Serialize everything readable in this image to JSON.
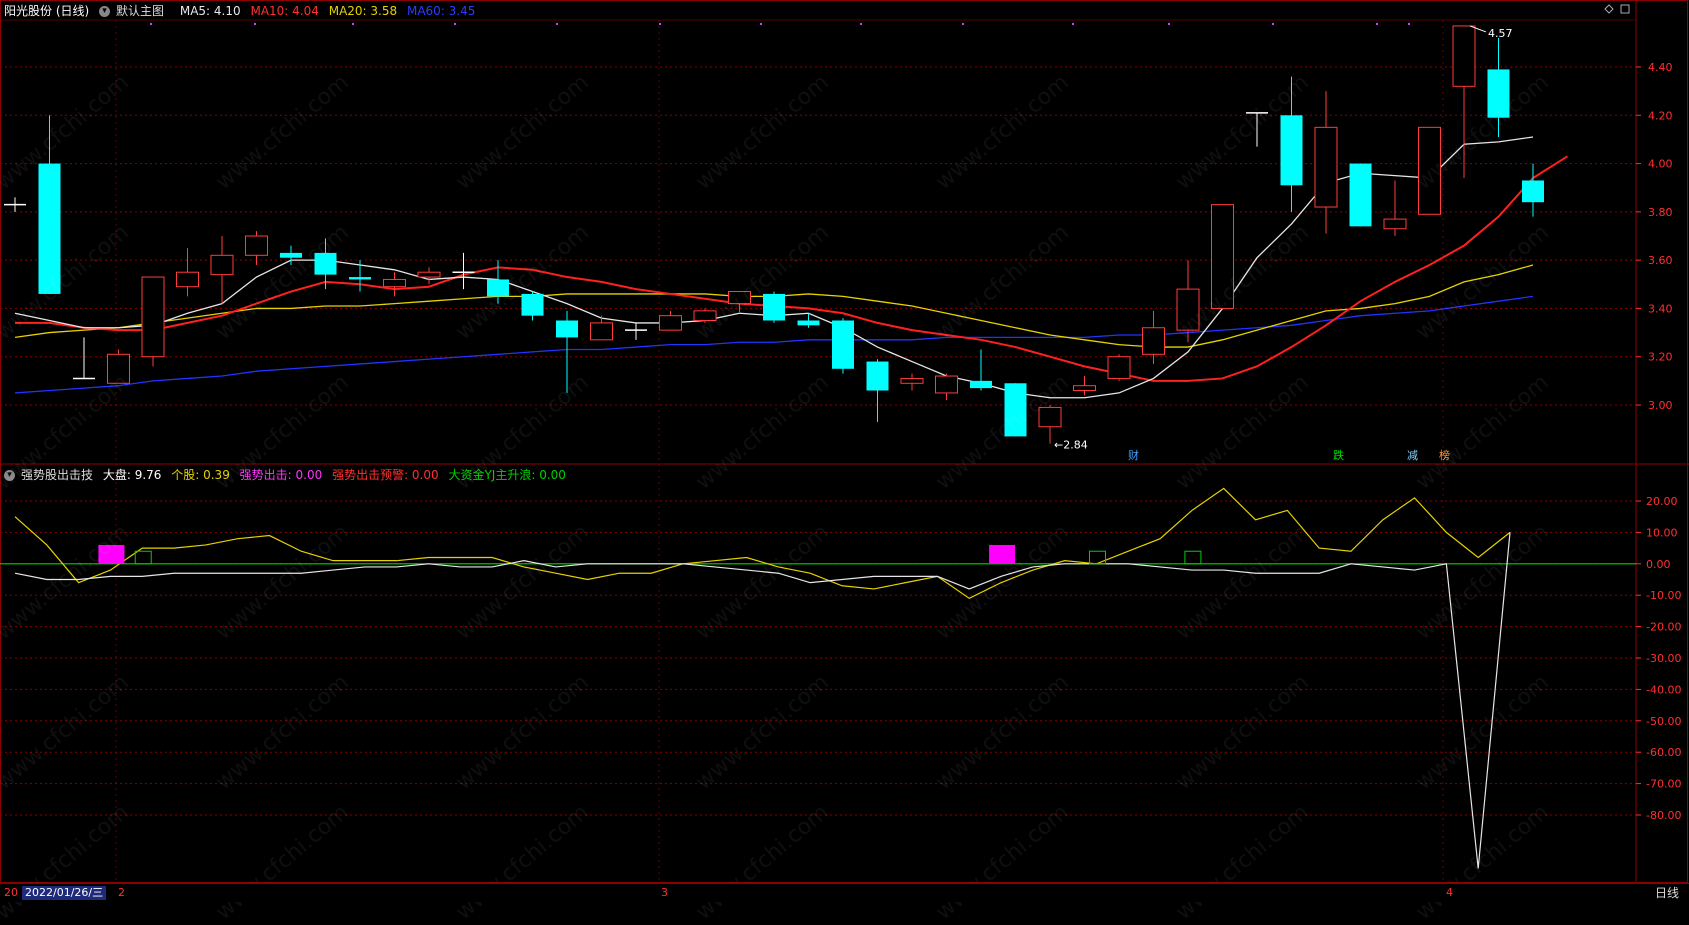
{
  "header": {
    "stock": "阳光股份 (日线)",
    "template": "默认主图",
    "ma5_label": "MA5: 4.10",
    "ma10_label": "MA10: 4.04",
    "ma20_label": "MA20: 3.58",
    "ma60_label": "MA60: 3.45"
  },
  "indicator_header": {
    "name": "强势股出击技",
    "dapan": "大盘: 9.76",
    "gegu": "个股: 0.39",
    "qiangshi": "强势出击: 0.00",
    "yujing": "强势出击预警: 0.00",
    "dazijin": "大资金YJ主升浪: 0.00"
  },
  "colors": {
    "up": "#ff3b3b",
    "down": "#00ffff",
    "ma5": "#e6e6e6",
    "ma10": "#ff2020",
    "ma20": "#e6d200",
    "ma60": "#2233ff",
    "grid": "#8b0000",
    "magenta": "#ff00ff",
    "green": "#00d000"
  },
  "footer": {
    "date": "2022/01/26/三",
    "period": "日线"
  },
  "price_ticks": [
    "4.40",
    "4.20",
    "4.00",
    "3.80",
    "3.60",
    "3.40",
    "3.20",
    "3.00"
  ],
  "indicator_ticks": [
    "20.00",
    "10.00",
    "0.00",
    "-10.00",
    "-20.00",
    "-30.00",
    "-40.00",
    "-50.00",
    "-60.00",
    "-70.00",
    "-80.00"
  ],
  "month_labels": [
    "2",
    "3",
    "4"
  ],
  "event_labels": [
    "财",
    "跌",
    "减",
    "榜"
  ],
  "annotations": {
    "high": "4.57",
    "low": "2.84"
  },
  "watermark": "www.cfchi.com",
  "chart_data": {
    "type": "candlestick",
    "price_range": [
      2.8,
      4.6
    ],
    "candles": [
      {
        "o": 3.83,
        "c": 3.83,
        "h": 3.86,
        "l": 3.8
      },
      {
        "o": 4.0,
        "c": 3.46,
        "h": 4.2,
        "l": 3.46
      },
      {
        "o": 3.11,
        "c": 3.11,
        "h": 3.28,
        "l": 3.11
      },
      {
        "o": 3.09,
        "c": 3.21,
        "h": 3.23,
        "l": 3.09
      },
      {
        "o": 3.2,
        "c": 3.53,
        "h": 3.53,
        "l": 3.16
      },
      {
        "o": 3.49,
        "c": 3.55,
        "h": 3.65,
        "l": 3.45
      },
      {
        "o": 3.54,
        "c": 3.62,
        "h": 3.7,
        "l": 3.42
      },
      {
        "o": 3.62,
        "c": 3.7,
        "h": 3.72,
        "l": 3.58
      },
      {
        "o": 3.63,
        "c": 3.61,
        "h": 3.66,
        "l": 3.58
      },
      {
        "o": 3.63,
        "c": 3.54,
        "h": 3.69,
        "l": 3.48
      },
      {
        "o": 3.53,
        "c": 3.52,
        "h": 3.6,
        "l": 3.47
      },
      {
        "o": 3.49,
        "c": 3.52,
        "h": 3.55,
        "l": 3.45
      },
      {
        "o": 3.53,
        "c": 3.55,
        "h": 3.57,
        "l": 3.5
      },
      {
        "o": 3.55,
        "c": 3.55,
        "h": 3.63,
        "l": 3.48
      },
      {
        "o": 3.52,
        "c": 3.45,
        "h": 3.6,
        "l": 3.42
      },
      {
        "o": 3.46,
        "c": 3.37,
        "h": 3.47,
        "l": 3.35
      },
      {
        "o": 3.35,
        "c": 3.28,
        "h": 3.39,
        "l": 3.05
      },
      {
        "o": 3.27,
        "c": 3.34,
        "h": 3.37,
        "l": 3.27
      },
      {
        "o": 3.31,
        "c": 3.31,
        "h": 3.34,
        "l": 3.27
      },
      {
        "o": 3.31,
        "c": 3.37,
        "h": 3.39,
        "l": 3.31
      },
      {
        "o": 3.35,
        "c": 3.39,
        "h": 3.4,
        "l": 3.34
      },
      {
        "o": 3.42,
        "c": 3.47,
        "h": 3.47,
        "l": 3.38
      },
      {
        "o": 3.46,
        "c": 3.35,
        "h": 3.47,
        "l": 3.34
      },
      {
        "o": 3.35,
        "c": 3.33,
        "h": 3.38,
        "l": 3.32
      },
      {
        "o": 3.35,
        "c": 3.15,
        "h": 3.36,
        "l": 3.13
      },
      {
        "o": 3.18,
        "c": 3.06,
        "h": 3.19,
        "l": 2.93
      },
      {
        "o": 3.09,
        "c": 3.11,
        "h": 3.13,
        "l": 3.06
      },
      {
        "o": 3.05,
        "c": 3.12,
        "h": 3.13,
        "l": 3.02
      },
      {
        "o": 3.1,
        "c": 3.07,
        "h": 3.23,
        "l": 3.06
      },
      {
        "o": 3.09,
        "c": 2.87,
        "h": 3.09,
        "l": 2.87
      },
      {
        "o": 2.91,
        "c": 2.99,
        "h": 3.0,
        "l": 2.84
      },
      {
        "o": 3.06,
        "c": 3.08,
        "h": 3.12,
        "l": 3.04
      },
      {
        "o": 3.11,
        "c": 3.2,
        "h": 3.21,
        "l": 3.1
      },
      {
        "o": 3.21,
        "c": 3.32,
        "h": 3.39,
        "l": 3.17
      },
      {
        "o": 3.31,
        "c": 3.48,
        "h": 3.6,
        "l": 3.26
      },
      {
        "o": 3.4,
        "c": 3.83,
        "h": 3.83,
        "l": 3.4
      },
      {
        "o": 4.21,
        "c": 4.21,
        "h": 4.21,
        "l": 4.07
      },
      {
        "o": 4.2,
        "c": 3.91,
        "h": 4.36,
        "l": 3.8
      },
      {
        "o": 3.82,
        "c": 4.15,
        "h": 4.3,
        "l": 3.71
      },
      {
        "o": 4.0,
        "c": 3.74,
        "h": 4.0,
        "l": 3.74
      },
      {
        "o": 3.73,
        "c": 3.77,
        "h": 3.93,
        "l": 3.7
      },
      {
        "o": 3.79,
        "c": 4.15,
        "h": 4.15,
        "l": 3.79
      },
      {
        "o": 4.32,
        "c": 4.57,
        "h": 4.57,
        "l": 3.94
      },
      {
        "o": 4.39,
        "c": 4.19,
        "h": 4.52,
        "l": 4.11
      },
      {
        "o": 3.93,
        "c": 3.84,
        "h": 4.0,
        "l": 3.78
      }
    ],
    "ma5": [
      3.38,
      3.35,
      3.32,
      3.32,
      3.33,
      3.38,
      3.42,
      3.53,
      3.6,
      3.6,
      3.58,
      3.56,
      3.52,
      3.53,
      3.52,
      3.47,
      3.42,
      3.36,
      3.34,
      3.34,
      3.35,
      3.38,
      3.37,
      3.38,
      3.32,
      3.24,
      3.18,
      3.12,
      3.09,
      3.05,
      3.03,
      3.03,
      3.05,
      3.11,
      3.22,
      3.4,
      3.61,
      3.75,
      3.92,
      3.96,
      3.95,
      3.94,
      4.08,
      4.09,
      4.11
    ],
    "ma10": [
      3.34,
      3.34,
      3.32,
      3.31,
      3.31,
      3.34,
      3.37,
      3.42,
      3.47,
      3.51,
      3.5,
      3.48,
      3.49,
      3.54,
      3.57,
      3.56,
      3.53,
      3.51,
      3.48,
      3.46,
      3.44,
      3.42,
      3.41,
      3.4,
      3.38,
      3.34,
      3.31,
      3.29,
      3.27,
      3.24,
      3.2,
      3.16,
      3.13,
      3.1,
      3.1,
      3.11,
      3.16,
      3.24,
      3.33,
      3.43,
      3.51,
      3.58,
      3.66,
      3.78,
      3.94,
      4.03
    ],
    "ma20": [
      3.28,
      3.3,
      3.31,
      3.32,
      3.34,
      3.36,
      3.38,
      3.4,
      3.4,
      3.41,
      3.41,
      3.42,
      3.43,
      3.44,
      3.45,
      3.45,
      3.46,
      3.46,
      3.46,
      3.46,
      3.46,
      3.45,
      3.45,
      3.46,
      3.45,
      3.43,
      3.41,
      3.38,
      3.35,
      3.32,
      3.29,
      3.27,
      3.25,
      3.24,
      3.24,
      3.27,
      3.31,
      3.35,
      3.39,
      3.4,
      3.42,
      3.45,
      3.51,
      3.54,
      3.58
    ],
    "ma60": [
      3.05,
      3.06,
      3.07,
      3.08,
      3.1,
      3.11,
      3.12,
      3.14,
      3.15,
      3.16,
      3.17,
      3.18,
      3.19,
      3.2,
      3.21,
      3.22,
      3.23,
      3.23,
      3.24,
      3.25,
      3.25,
      3.26,
      3.26,
      3.27,
      3.27,
      3.27,
      3.27,
      3.28,
      3.28,
      3.28,
      3.28,
      3.28,
      3.29,
      3.29,
      3.3,
      3.31,
      3.32,
      3.33,
      3.35,
      3.37,
      3.38,
      3.39,
      3.41,
      3.43,
      3.45
    ],
    "indicator_range": [
      -88,
      25
    ],
    "ind_white": [
      -3,
      -5,
      -5,
      -4,
      -4,
      -3,
      -3,
      -3,
      -3,
      -3,
      -2,
      -1,
      -1,
      0,
      -1,
      -1,
      1,
      -1,
      0,
      0,
      0,
      0,
      -1,
      -2,
      -3,
      -6,
      -5,
      -4,
      -4,
      -4,
      -8,
      -4,
      -1,
      0,
      0,
      0,
      -1,
      -2,
      -2,
      -3,
      -3,
      -3,
      0,
      -1,
      -2,
      0,
      -97,
      10
    ],
    "ind_yellow": [
      15,
      6,
      -6,
      -2,
      5,
      5,
      6,
      8,
      9,
      4,
      1,
      1,
      1,
      2,
      2,
      2,
      -1,
      -3,
      -5,
      -3,
      -3,
      0,
      1,
      2,
      -1,
      -3,
      -7,
      -8,
      -6,
      -4,
      -11,
      -6,
      -2,
      1,
      0,
      4,
      8,
      17,
      24,
      14,
      17,
      5,
      4,
      14,
      21,
      10,
      2,
      10
    ],
    "ind_green": 0,
    "ind_bars": [
      {
        "i": 3,
        "v": 6,
        "c": "magenta"
      },
      {
        "i": 4,
        "v": 4,
        "c": "green"
      },
      {
        "i": 31,
        "v": 6,
        "c": "magenta"
      },
      {
        "i": 34,
        "v": 4,
        "c": "green"
      },
      {
        "i": 37,
        "v": 4,
        "c": "green"
      }
    ]
  }
}
